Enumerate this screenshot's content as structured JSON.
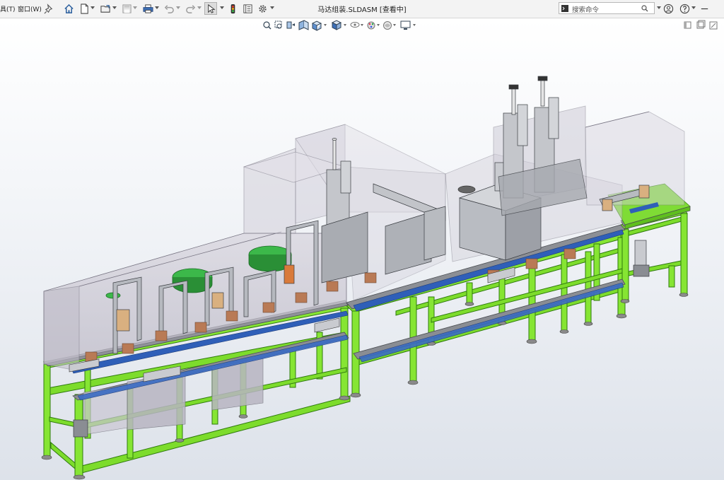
{
  "menu": {
    "tools": "具(T)",
    "window": "窗口(W)"
  },
  "window_title": "马达组装.SLDASM [查看中]",
  "search": {
    "placeholder": "搜索命令"
  },
  "icons": {
    "toolbar": [
      "pin-icon",
      "home-icon",
      "new-document-icon",
      "open-folder-icon",
      "save-icon",
      "print-icon",
      "undo-icon",
      "redo-icon",
      "select-arrow-icon",
      "traffic-light-icon",
      "file-properties-icon",
      "options-gear-icon"
    ],
    "right": [
      "user-icon",
      "help-icon",
      "restore-icon"
    ],
    "view": [
      "zoom-to-fit-icon",
      "zoom-area-icon",
      "previous-view-icon",
      "section-view-icon",
      "view-orientation-icon",
      "display-style-icon",
      "hide-show-icon",
      "edit-appearance-icon",
      "apply-scene-icon",
      "view-settings-icon"
    ]
  },
  "colors": {
    "frame": "#7be02a",
    "frame_dark": "#3f8f14",
    "panel": "#7c7f86",
    "enclosure": "#c9c5d2",
    "belt": "#2c5db5",
    "accent_green": "#3cb84a"
  }
}
